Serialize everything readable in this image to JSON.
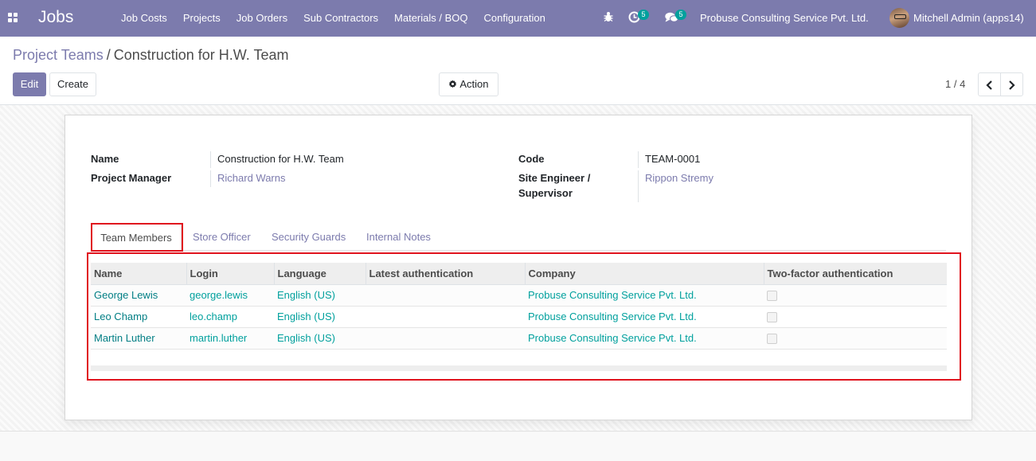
{
  "navbar": {
    "brand": "Jobs",
    "menu": [
      "Job Costs",
      "Projects",
      "Job Orders",
      "Sub Contractors",
      "Materials / BOQ",
      "Configuration"
    ],
    "activity_count": "5",
    "messages_count": "5",
    "company": "Probuse Consulting Service Pvt. Ltd.",
    "user": "Mitchell Admin (apps14)"
  },
  "breadcrumb": {
    "parent": "Project Teams",
    "separator": "/",
    "current": "Construction for H.W. Team"
  },
  "buttons": {
    "edit": "Edit",
    "create": "Create",
    "action": "Action"
  },
  "pager": {
    "value": "1 / 4"
  },
  "form": {
    "name_label": "Name",
    "name_value": "Construction for H.W. Team",
    "pm_label": "Project Manager",
    "pm_value": "Richard Warns",
    "code_label": "Code",
    "code_value": "TEAM-0001",
    "site_label_line1": "Site Engineer /",
    "site_label_line2": "Supervisor",
    "site_value": "Rippon Stremy"
  },
  "tabs": [
    "Team Members",
    "Store Officer",
    "Security Guards",
    "Internal Notes"
  ],
  "table": {
    "headers": [
      "Name",
      "Login",
      "Language",
      "Latest authentication",
      "Company",
      "Two-factor authentication"
    ],
    "rows": [
      [
        "George Lewis",
        "george.lewis",
        "English (US)",
        "",
        "Probuse Consulting Service Pvt. Ltd."
      ],
      [
        "Leo Champ",
        "leo.champ",
        "English (US)",
        "",
        "Probuse Consulting Service Pvt. Ltd."
      ],
      [
        "Martin Luther",
        "martin.luther",
        "English (US)",
        "",
        "Probuse Consulting Service Pvt. Ltd."
      ]
    ]
  },
  "colors": {
    "brand": "#7c7bad",
    "link": "#00a09d",
    "highlight": "#e0141e"
  }
}
